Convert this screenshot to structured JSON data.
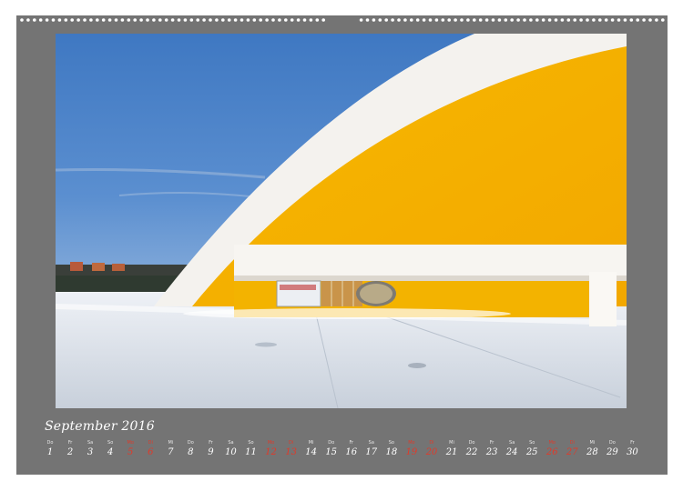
{
  "calendar": {
    "month_title": "September 2016",
    "days": [
      {
        "name": "Do",
        "num": "1",
        "weekend": false
      },
      {
        "name": "Fr",
        "num": "2",
        "weekend": false
      },
      {
        "name": "Sa",
        "num": "3",
        "weekend": false
      },
      {
        "name": "So",
        "num": "4",
        "weekend": false
      },
      {
        "name": "Mo",
        "num": "5",
        "weekend": true
      },
      {
        "name": "Di",
        "num": "6",
        "weekend": true
      },
      {
        "name": "Mi",
        "num": "7",
        "weekend": false
      },
      {
        "name": "Do",
        "num": "8",
        "weekend": false
      },
      {
        "name": "Fr",
        "num": "9",
        "weekend": false
      },
      {
        "name": "Sa",
        "num": "10",
        "weekend": false
      },
      {
        "name": "So",
        "num": "11",
        "weekend": false
      },
      {
        "name": "Mo",
        "num": "12",
        "weekend": true
      },
      {
        "name": "Di",
        "num": "13",
        "weekend": true
      },
      {
        "name": "Mi",
        "num": "14",
        "weekend": false
      },
      {
        "name": "Do",
        "num": "15",
        "weekend": false
      },
      {
        "name": "Fr",
        "num": "16",
        "weekend": false
      },
      {
        "name": "Sa",
        "num": "17",
        "weekend": false
      },
      {
        "name": "So",
        "num": "18",
        "weekend": false
      },
      {
        "name": "Mo",
        "num": "19",
        "weekend": true
      },
      {
        "name": "Di",
        "num": "20",
        "weekend": true
      },
      {
        "name": "Mi",
        "num": "21",
        "weekend": false
      },
      {
        "name": "Do",
        "num": "22",
        "weekend": false
      },
      {
        "name": "Fr",
        "num": "23",
        "weekend": false
      },
      {
        "name": "Sa",
        "num": "24",
        "weekend": false
      },
      {
        "name": "So",
        "num": "25",
        "weekend": false
      },
      {
        "name": "Mo",
        "num": "26",
        "weekend": true
      },
      {
        "name": "Di",
        "num": "27",
        "weekend": true
      },
      {
        "name": "Mi",
        "num": "28",
        "weekend": false
      },
      {
        "name": "Do",
        "num": "29",
        "weekend": false
      },
      {
        "name": "Fr",
        "num": "30",
        "weekend": false
      }
    ]
  },
  "colors": {
    "page_background": "#747474",
    "weekend_text": "#e03a2a",
    "sky": "#4f86c8",
    "facade_yellow": "#f5b400",
    "shell_white": "#f4f2ee"
  }
}
